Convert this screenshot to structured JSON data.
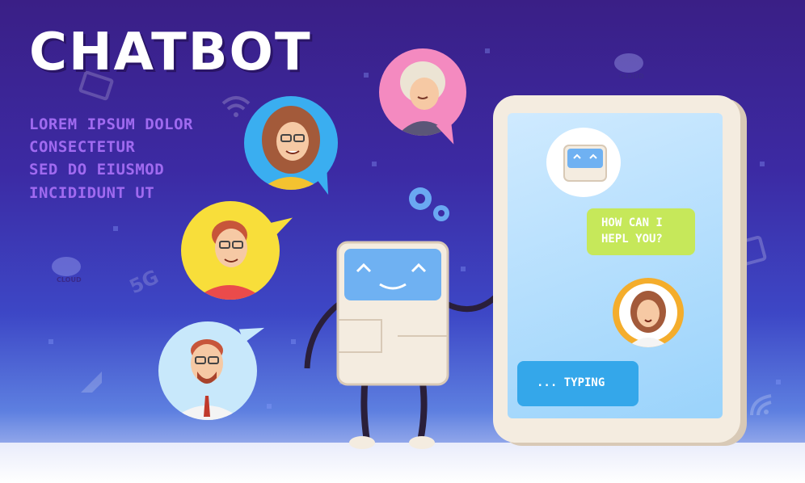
{
  "headline": "CHATBOT",
  "subtext": [
    "LOREM IPSUM DOLOR",
    "CONSECTETUR",
    "SED DO EIUSMOD",
    "INCIDIDUNT UT"
  ],
  "chat": {
    "bot_message_lines": [
      "HOW CAN I",
      "HEPL YOU?"
    ],
    "typing_text": "... TYPING"
  },
  "decorations": {
    "cloud_label": "CLOUD",
    "network_label": "5G"
  },
  "icons": [
    "wifi-icon",
    "cloud-icon",
    "gears-icon",
    "monitor-icon",
    "cursor-icon",
    "5g-icon"
  ],
  "colors": {
    "background_top": "#3a1f86",
    "background_bottom": "#5d7fe0",
    "headline": "#ffffff",
    "subtext": "#a06af0",
    "message_green": "#c6e85a",
    "message_blue": "#34a7ea",
    "phone_body": "#f4ece0",
    "screen": "#9ad3fb",
    "robot_face": "#6fb1f2"
  }
}
